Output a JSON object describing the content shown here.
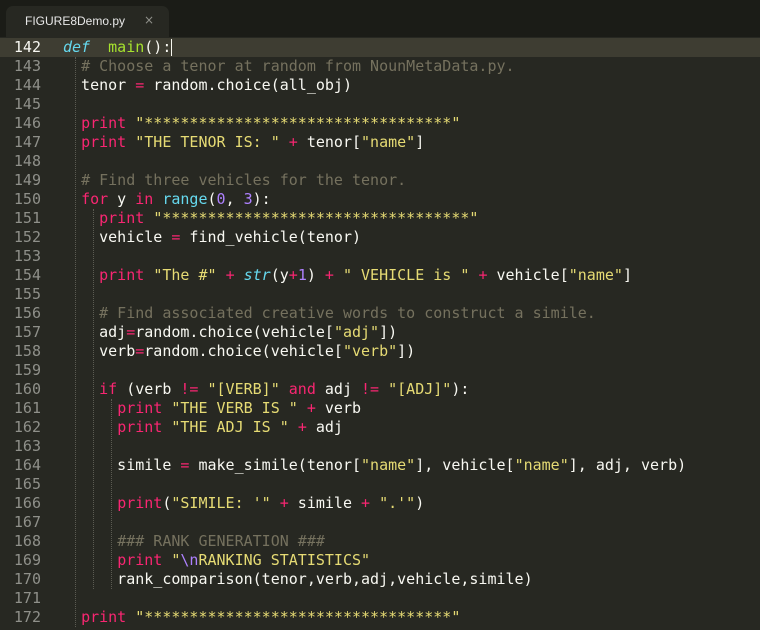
{
  "tab": {
    "title": "FIGURE8Demo.py",
    "close_glyph": "×"
  },
  "colors": {
    "background": "#272822",
    "keyword": "#f92672",
    "string": "#e6db74",
    "comment": "#75715e",
    "function": "#a6e22e",
    "builtin": "#66d9ef",
    "number": "#ae81ff"
  },
  "current_line": 142,
  "lines": [
    {
      "n": 142,
      "tokens": [
        [
          "it",
          "def"
        ],
        [
          "",
          "  "
        ],
        [
          "fn",
          "main"
        ],
        [
          "",
          "():"
        ]
      ]
    },
    {
      "n": 143,
      "tokens": [
        [
          "",
          "  "
        ],
        [
          "cm",
          "# Choose a tenor at random from NounMetaData.py."
        ]
      ]
    },
    {
      "n": 144,
      "tokens": [
        [
          "",
          "  tenor "
        ],
        [
          "kw",
          "="
        ],
        [
          "",
          " random.choice(all_obj)"
        ]
      ]
    },
    {
      "n": 145,
      "tokens": []
    },
    {
      "n": 146,
      "tokens": [
        [
          "",
          "  "
        ],
        [
          "kw",
          "print"
        ],
        [
          "",
          " "
        ],
        [
          "st",
          "\"**********************************\""
        ]
      ]
    },
    {
      "n": 147,
      "tokens": [
        [
          "",
          "  "
        ],
        [
          "kw",
          "print"
        ],
        [
          "",
          " "
        ],
        [
          "st",
          "\"THE TENOR IS: \""
        ],
        [
          "",
          " "
        ],
        [
          "kw",
          "+"
        ],
        [
          "",
          " tenor["
        ],
        [
          "st",
          "\"name\""
        ],
        [
          "",
          "]"
        ]
      ]
    },
    {
      "n": 148,
      "tokens": []
    },
    {
      "n": 149,
      "tokens": [
        [
          "",
          "  "
        ],
        [
          "cm",
          "# Find three vehicles for the tenor."
        ]
      ]
    },
    {
      "n": 150,
      "tokens": [
        [
          "",
          "  "
        ],
        [
          "kw",
          "for"
        ],
        [
          "",
          " y "
        ],
        [
          "kw",
          "in"
        ],
        [
          "",
          " "
        ],
        [
          "bi",
          "range"
        ],
        [
          "",
          "("
        ],
        [
          "nm",
          "0"
        ],
        [
          "",
          ", "
        ],
        [
          "nm",
          "3"
        ],
        [
          "",
          "):"
        ]
      ]
    },
    {
      "n": 151,
      "tokens": [
        [
          "",
          "    "
        ],
        [
          "kw",
          "print"
        ],
        [
          "",
          " "
        ],
        [
          "st",
          "\"**********************************\""
        ]
      ]
    },
    {
      "n": 152,
      "tokens": [
        [
          "",
          "    vehicle "
        ],
        [
          "kw",
          "="
        ],
        [
          "",
          " find_vehicle(tenor)"
        ]
      ]
    },
    {
      "n": 153,
      "tokens": []
    },
    {
      "n": 154,
      "tokens": [
        [
          "",
          "    "
        ],
        [
          "kw",
          "print"
        ],
        [
          "",
          " "
        ],
        [
          "st",
          "\"The #\""
        ],
        [
          "",
          " "
        ],
        [
          "kw",
          "+"
        ],
        [
          "",
          " "
        ],
        [
          "it",
          "str"
        ],
        [
          "",
          "(y"
        ],
        [
          "kw",
          "+"
        ],
        [
          "nm",
          "1"
        ],
        [
          "",
          ") "
        ],
        [
          "kw",
          "+"
        ],
        [
          "",
          " "
        ],
        [
          "st",
          "\" VEHICLE is \""
        ],
        [
          "",
          " "
        ],
        [
          "kw",
          "+"
        ],
        [
          "",
          " vehicle["
        ],
        [
          "st",
          "\"name\""
        ],
        [
          "",
          "]"
        ]
      ]
    },
    {
      "n": 155,
      "tokens": []
    },
    {
      "n": 156,
      "tokens": [
        [
          "",
          "    "
        ],
        [
          "cm",
          "# Find associated creative words to construct a simile."
        ]
      ]
    },
    {
      "n": 157,
      "tokens": [
        [
          "",
          "    adj"
        ],
        [
          "kw",
          "="
        ],
        [
          "",
          "random.choice(vehicle["
        ],
        [
          "st",
          "\"adj\""
        ],
        [
          "",
          "])"
        ]
      ]
    },
    {
      "n": 158,
      "tokens": [
        [
          "",
          "    verb"
        ],
        [
          "kw",
          "="
        ],
        [
          "",
          "random.choice(vehicle["
        ],
        [
          "st",
          "\"verb\""
        ],
        [
          "",
          "])"
        ]
      ]
    },
    {
      "n": 159,
      "tokens": []
    },
    {
      "n": 160,
      "tokens": [
        [
          "",
          "    "
        ],
        [
          "kw",
          "if"
        ],
        [
          "",
          " (verb "
        ],
        [
          "kw",
          "!="
        ],
        [
          "",
          " "
        ],
        [
          "st",
          "\"[VERB]\""
        ],
        [
          "",
          " "
        ],
        [
          "kw",
          "and"
        ],
        [
          "",
          " adj "
        ],
        [
          "kw",
          "!="
        ],
        [
          "",
          " "
        ],
        [
          "st",
          "\"[ADJ]\""
        ],
        [
          "",
          "):"
        ]
      ]
    },
    {
      "n": 161,
      "tokens": [
        [
          "",
          "      "
        ],
        [
          "kw",
          "print"
        ],
        [
          "",
          " "
        ],
        [
          "st",
          "\"THE VERB IS \""
        ],
        [
          "",
          " "
        ],
        [
          "kw",
          "+"
        ],
        [
          "",
          " verb"
        ]
      ]
    },
    {
      "n": 162,
      "tokens": [
        [
          "",
          "      "
        ],
        [
          "kw",
          "print"
        ],
        [
          "",
          " "
        ],
        [
          "st",
          "\"THE ADJ IS \""
        ],
        [
          "",
          " "
        ],
        [
          "kw",
          "+"
        ],
        [
          "",
          " adj"
        ]
      ]
    },
    {
      "n": 163,
      "tokens": []
    },
    {
      "n": 164,
      "tokens": [
        [
          "",
          "      simile "
        ],
        [
          "kw",
          "="
        ],
        [
          "",
          " make_simile(tenor["
        ],
        [
          "st",
          "\"name\""
        ],
        [
          "",
          "], vehicle["
        ],
        [
          "st",
          "\"name\""
        ],
        [
          "",
          "], adj, verb)"
        ]
      ]
    },
    {
      "n": 165,
      "tokens": []
    },
    {
      "n": 166,
      "tokens": [
        [
          "",
          "      "
        ],
        [
          "kw",
          "print"
        ],
        [
          "",
          "("
        ],
        [
          "st",
          "\"SIMILE: '\""
        ],
        [
          "",
          " "
        ],
        [
          "kw",
          "+"
        ],
        [
          "",
          " simile "
        ],
        [
          "kw",
          "+"
        ],
        [
          "",
          " "
        ],
        [
          "st",
          "\".'\""
        ],
        [
          "",
          ")"
        ]
      ]
    },
    {
      "n": 167,
      "tokens": []
    },
    {
      "n": 168,
      "tokens": [
        [
          "",
          "      "
        ],
        [
          "cm",
          "### RANK GENERATION ###"
        ]
      ]
    },
    {
      "n": 169,
      "tokens": [
        [
          "",
          "      "
        ],
        [
          "kw",
          "print"
        ],
        [
          "",
          " "
        ],
        [
          "st",
          "\""
        ],
        [
          "nm",
          "\\n"
        ],
        [
          "st",
          "RANKING STATISTICS\""
        ]
      ]
    },
    {
      "n": 170,
      "tokens": [
        [
          "",
          "      rank_comparison(tenor,verb,adj,vehicle,simile)"
        ]
      ]
    },
    {
      "n": 171,
      "tokens": []
    },
    {
      "n": 172,
      "tokens": [
        [
          "",
          "  "
        ],
        [
          "kw",
          "print"
        ],
        [
          "",
          " "
        ],
        [
          "st",
          "\"**********************************\""
        ]
      ]
    }
  ]
}
